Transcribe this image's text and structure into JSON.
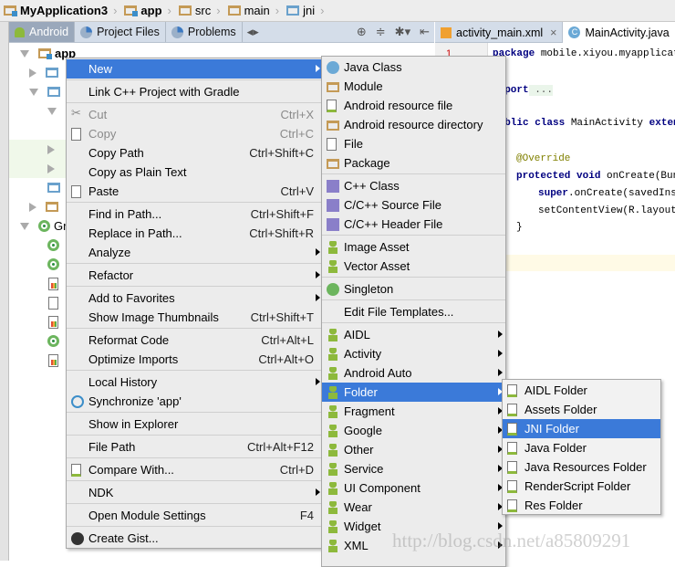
{
  "breadcrumbs": [
    "MyApplication3",
    "app",
    "src",
    "main",
    "jni"
  ],
  "project_tabs": [
    {
      "label": "Android",
      "active": true
    },
    {
      "label": "Project Files"
    },
    {
      "label": "Problems"
    }
  ],
  "toolbar_icons": [
    "arrows-icon",
    "locate-icon",
    "collapse-icon",
    "gear-icon",
    "hide-icon"
  ],
  "tree": {
    "root": "app",
    "gradle_label": "Grad"
  },
  "editor": {
    "tabs": [
      {
        "label": "activity_main.xml",
        "close": "×"
      },
      {
        "label": "MainActivity.java",
        "active": true
      }
    ],
    "line_number": "1",
    "code": [
      {
        "kw": "package",
        "rest": " mobile.xiyou.myapplicati"
      },
      {
        "kw": "import",
        "rest": " ..."
      },
      {
        "kw": "public class",
        "rest": " MainActivity ",
        "kw2": "exten"
      },
      {
        "ann": "@Override"
      },
      {
        "kw": "protected void",
        "rest": " onCreate(Bun"
      },
      {
        "kw": "super",
        "rest": ".onCreate(savedInst"
      },
      {
        "rest": "setContentView(R.layout.a"
      },
      {
        "rest": "}"
      }
    ]
  },
  "menu1": [
    {
      "label": "New",
      "selected": true,
      "submenu": true
    },
    {
      "sep": true
    },
    {
      "label": "Link C++ Project with Gradle"
    },
    {
      "sep": true
    },
    {
      "label": "Cut",
      "shortcut": "Ctrl+X",
      "disabled": true,
      "icon": "scissors-icon"
    },
    {
      "label": "Copy",
      "shortcut": "Ctrl+C",
      "disabled": true,
      "icon": "copy-icon"
    },
    {
      "label": "Copy Path",
      "shortcut": "Ctrl+Shift+C"
    },
    {
      "label": "Copy as Plain Text"
    },
    {
      "label": "Paste",
      "shortcut": "Ctrl+V",
      "icon": "paste-icon"
    },
    {
      "sep": true
    },
    {
      "label": "Find in Path...",
      "shortcut": "Ctrl+Shift+F"
    },
    {
      "label": "Replace in Path...",
      "shortcut": "Ctrl+Shift+R"
    },
    {
      "label": "Analyze",
      "submenu": true
    },
    {
      "sep": true
    },
    {
      "label": "Refactor",
      "submenu": true
    },
    {
      "sep": true
    },
    {
      "label": "Add to Favorites",
      "submenu": true
    },
    {
      "label": "Show Image Thumbnails",
      "shortcut": "Ctrl+Shift+T"
    },
    {
      "sep": true
    },
    {
      "label": "Reformat Code",
      "shortcut": "Ctrl+Alt+L"
    },
    {
      "label": "Optimize Imports",
      "shortcut": "Ctrl+Alt+O"
    },
    {
      "sep": true
    },
    {
      "label": "Local History",
      "submenu": true
    },
    {
      "label": "Synchronize 'app'",
      "icon": "sync-icon"
    },
    {
      "sep": true
    },
    {
      "label": "Show in Explorer"
    },
    {
      "sep": true
    },
    {
      "label": "File Path",
      "shortcut": "Ctrl+Alt+F12"
    },
    {
      "sep": true
    },
    {
      "label": "Compare With...",
      "shortcut": "Ctrl+D",
      "icon": "compare-icon"
    },
    {
      "sep": true
    },
    {
      "label": "NDK",
      "submenu": true
    },
    {
      "sep": true
    },
    {
      "label": "Open Module Settings",
      "shortcut": "F4"
    },
    {
      "sep": true
    },
    {
      "label": "Create Gist...",
      "icon": "github-icon"
    }
  ],
  "menu2": [
    {
      "label": "Java Class",
      "icon": "java-class-icon"
    },
    {
      "label": "Module",
      "icon": "module-icon"
    },
    {
      "label": "Android resource file",
      "icon": "android-file-icon"
    },
    {
      "label": "Android resource directory",
      "icon": "folder-icon"
    },
    {
      "label": "File",
      "icon": "file-icon"
    },
    {
      "label": "Package",
      "icon": "package-icon"
    },
    {
      "sep": true
    },
    {
      "label": "C++ Class",
      "icon": "cpp-class-icon"
    },
    {
      "label": "C/C++ Source File",
      "icon": "cpp-source-icon"
    },
    {
      "label": "C/C++ Header File",
      "icon": "cpp-header-icon"
    },
    {
      "sep": true
    },
    {
      "label": "Image Asset",
      "icon": "android-icon"
    },
    {
      "label": "Vector Asset",
      "icon": "android-icon"
    },
    {
      "sep": true
    },
    {
      "label": "Singleton",
      "icon": "singleton-icon"
    },
    {
      "sep": true
    },
    {
      "label": "Edit File Templates..."
    },
    {
      "sep": true
    },
    {
      "label": "AIDL",
      "icon": "android-icon",
      "submenu": true
    },
    {
      "label": "Activity",
      "icon": "android-icon",
      "submenu": true
    },
    {
      "label": "Android Auto",
      "icon": "android-icon",
      "submenu": true
    },
    {
      "label": "Folder",
      "icon": "android-icon",
      "submenu": true,
      "selected": true
    },
    {
      "label": "Fragment",
      "icon": "android-icon",
      "submenu": true
    },
    {
      "label": "Google",
      "icon": "android-icon",
      "submenu": true
    },
    {
      "label": "Other",
      "icon": "android-icon",
      "submenu": true
    },
    {
      "label": "Service",
      "icon": "android-icon",
      "submenu": true
    },
    {
      "label": "UI Component",
      "icon": "android-icon",
      "submenu": true
    },
    {
      "label": "Wear",
      "icon": "android-icon",
      "submenu": true
    },
    {
      "label": "Widget",
      "icon": "android-icon",
      "submenu": true
    },
    {
      "label": "XML",
      "icon": "android-icon",
      "submenu": true
    }
  ],
  "menu3": [
    {
      "label": "AIDL Folder",
      "icon": "android-folder-icon"
    },
    {
      "label": "Assets Folder",
      "icon": "android-folder-icon"
    },
    {
      "label": "JNI Folder",
      "icon": "android-folder-icon",
      "selected": true
    },
    {
      "label": "Java Folder",
      "icon": "android-folder-icon"
    },
    {
      "label": "Java Resources Folder",
      "icon": "android-folder-icon"
    },
    {
      "label": "RenderScript Folder",
      "icon": "android-folder-icon"
    },
    {
      "label": "Res Folder",
      "icon": "android-folder-icon"
    }
  ],
  "watermark": "http://blog.csdn.net/a85809291",
  "colors": {
    "selection": "#3b7ad9",
    "menu_bg": "#ececec",
    "android_green": "#8db93c",
    "keyword": "#000080"
  }
}
